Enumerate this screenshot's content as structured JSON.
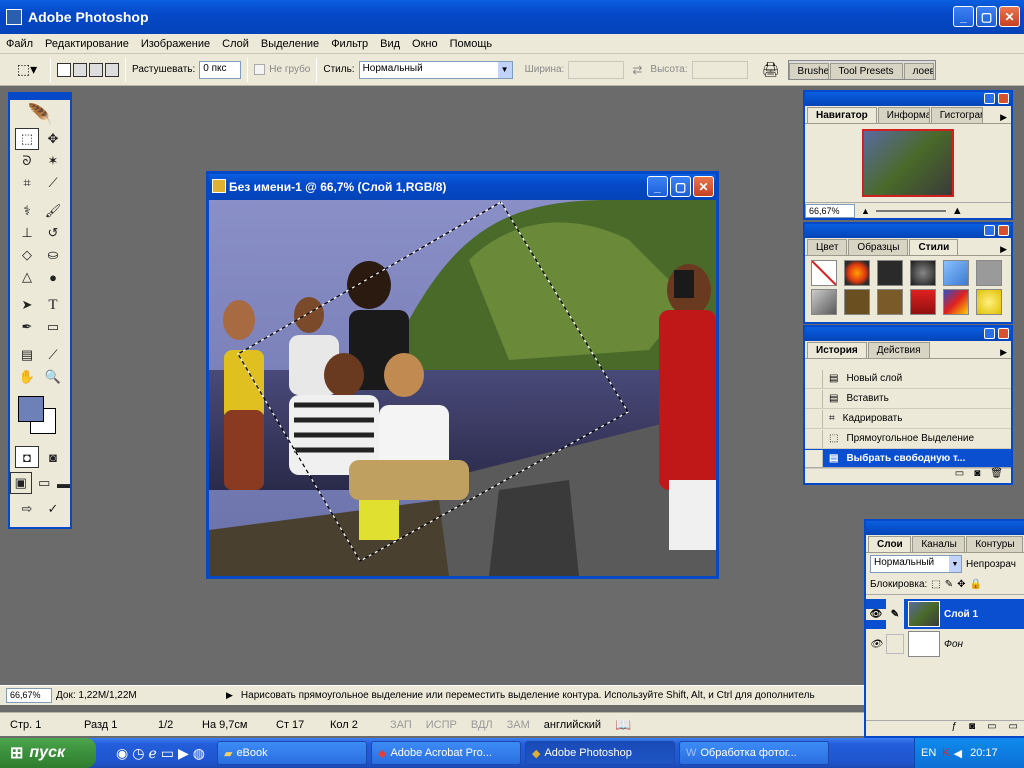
{
  "app": {
    "title": "Adobe Photoshop"
  },
  "menu": [
    "Файл",
    "Редактирование",
    "Изображение",
    "Слой",
    "Выделение",
    "Фильтр",
    "Вид",
    "Окно",
    "Помощь"
  ],
  "options": {
    "feather_label": "Растушевать:",
    "feather_value": "0 пкс",
    "antialias_label": "Не грубо",
    "style_label": "Стиль:",
    "style_value": "Нормальный",
    "width_label": "Ширина:",
    "height_label": "Высота:",
    "palette_tabs": [
      "Brushe",
      "Tool Presets",
      "лоев"
    ]
  },
  "document": {
    "title": "Без имени-1 @ 66,7% (Слой 1,RGB/8)"
  },
  "navigator": {
    "tabs": [
      "Навигатор",
      "Информация",
      "Гистограмма"
    ],
    "zoom": "66,67%"
  },
  "styles_panel": {
    "tabs": [
      "Цвет",
      "Образцы",
      "Стили"
    ],
    "swatches": [
      "#ffffff",
      "#e03a10",
      "#2a2a2a",
      "#1a1a1a",
      "#3a7ad0",
      "#9a9a9a",
      "#5a5a5a",
      "#6a5020",
      "#6a5020",
      "#c02020",
      "#3050c0",
      "#e0c000"
    ]
  },
  "history": {
    "tabs": [
      "История",
      "Действия"
    ],
    "items": [
      "Новый слой",
      "Вставить",
      "Кадрировать",
      "Прямоугольное Выделение",
      "Выбрать свободную т..."
    ]
  },
  "layers": {
    "tabs": [
      "Слои",
      "Каналы",
      "Контуры"
    ],
    "blend": "Нормальный",
    "opacity_label": "Непрозрач",
    "lock_label": "Блокировка:",
    "items": [
      {
        "name": "Слой 1",
        "selected": true
      },
      {
        "name": "Фон",
        "selected": false
      }
    ]
  },
  "status": {
    "zoom": "66,67%",
    "doc": "Док: 1,22M/1,22M",
    "hint": "Нарисовать прямоугольное выделение или переместить выделение контура.  Используйте Shift, Alt, и Ctrl для дополнитель"
  },
  "word_status": [
    "Стр. 1",
    "Разд 1",
    "1/2",
    "На 9,7см",
    "Ст 17",
    "Кол 2",
    "ЗАП",
    "ИСПР",
    "ВДЛ",
    "ЗАМ",
    "английский"
  ],
  "taskbar": {
    "start": "пуск",
    "tasks": [
      {
        "label": "eBook",
        "active": false
      },
      {
        "label": "Adobe Acrobat Pro...",
        "active": false
      },
      {
        "label": "Adobe Photoshop",
        "active": true
      },
      {
        "label": "Обработка фотог...",
        "active": false
      }
    ],
    "lang": "EN",
    "clock": "20:17"
  },
  "colors": {
    "foreground": "#6e80b8",
    "background": "#ffffff",
    "accent": "#0548c8"
  }
}
